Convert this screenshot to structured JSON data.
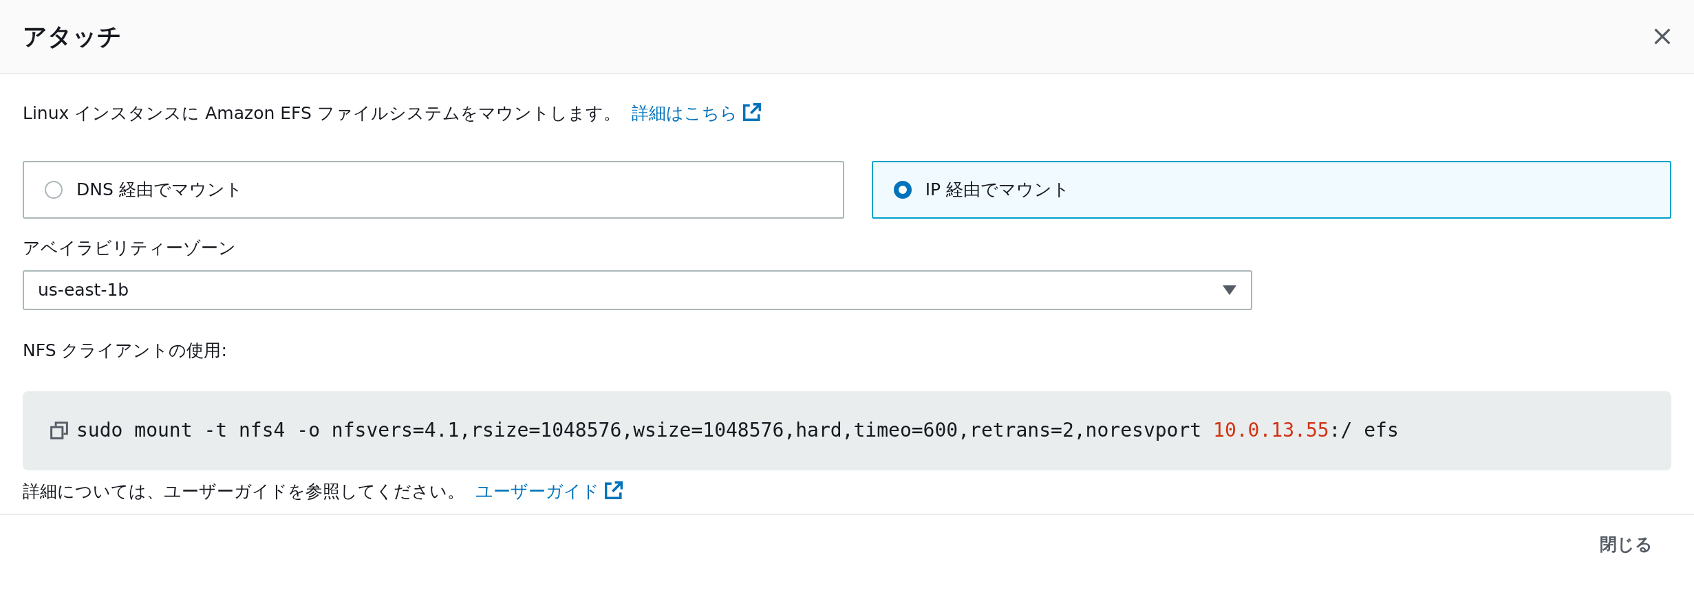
{
  "dialog": {
    "title": "アタッチ",
    "description": "Linux インスタンスに Amazon EFS ファイルシステムをマウントします。",
    "description_link": "詳細はこちら",
    "mount_options": [
      {
        "label": "DNS 経由でマウント",
        "selected": false
      },
      {
        "label": "IP 経由でマウント",
        "selected": true
      }
    ],
    "availability_zone": {
      "label": "アベイラビリティーゾーン",
      "value": "us-east-1b"
    },
    "nfs_label": "NFS クライアントの使用:",
    "command": [
      {
        "text": "sudo mount -t nfs4 -o nfsvers=4.1,rsize=1048576,wsize=1048576,hard,timeo=600,retrans=2,noresvport ",
        "highlight": false
      },
      {
        "text": "10.0.13.55",
        "highlight": true
      },
      {
        "text": ":/ efs",
        "highlight": false
      }
    ],
    "guide_text": "詳細については、ユーザーガイドを参照してください。",
    "guide_link": "ユーザーガイド",
    "close_button": "閉じる"
  }
}
